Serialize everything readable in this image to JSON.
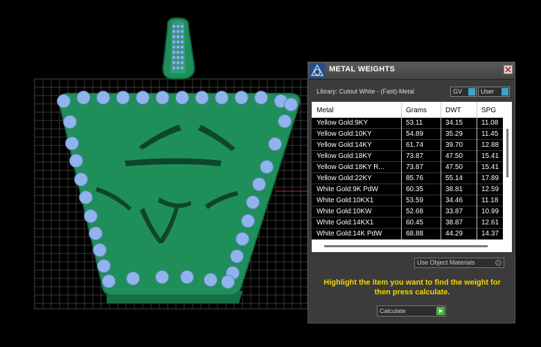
{
  "panel": {
    "title": "METAL WEIGHTS",
    "library_label": "Library: Cutout White - (Fast)-Metal",
    "gv_label": "GV",
    "user_label": "User",
    "columns": [
      "Metal",
      "Grams",
      "DWT",
      "SPG"
    ],
    "rows": [
      [
        "Yellow Gold:9KY",
        "53.11",
        "34.15",
        "11.08"
      ],
      [
        "Yellow Gold:10KY",
        "54.89",
        "35.29",
        "11.45"
      ],
      [
        "Yellow Gold:14KY",
        "61.74",
        "39.70",
        "12.88"
      ],
      [
        "Yellow Gold:18KY",
        "73.87",
        "47.50",
        "15.41"
      ],
      [
        "Yellow Gold:18KY R...",
        "73.87",
        "47.50",
        "15.41"
      ],
      [
        "Yellow Gold:22KY",
        "85.76",
        "55.14",
        "17.89"
      ],
      [
        "White Gold:9K PdW",
        "60.35",
        "38.81",
        "12.59"
      ],
      [
        "White Gold:10KX1",
        "53.59",
        "34.46",
        "11.18"
      ],
      [
        "White Gold:10KW",
        "52.68",
        "33.87",
        "10.99"
      ],
      [
        "White Gold:14KX1",
        "60.45",
        "38.87",
        "12.61"
      ],
      [
        "White Gold:14K PdW",
        "68.88",
        "44.29",
        "14.37"
      ]
    ],
    "use_object_materials": "Use Object Materials",
    "hint": "Highlight the item you want to find the weight for then press calculate.",
    "calculate_label": "Calculate"
  },
  "colors": {
    "pendant_green": "#1f8f5a",
    "stone_blue": "#8fb4ea",
    "hint_yellow": "#f2d600",
    "grid": "#3a3a3a"
  }
}
